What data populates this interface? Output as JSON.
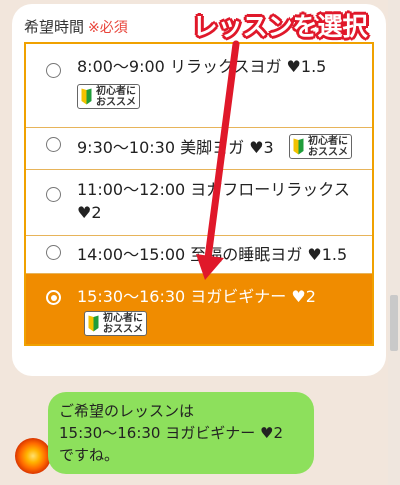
{
  "form": {
    "label": "希望時間",
    "required_mark": "※必須"
  },
  "options": [
    {
      "text": "8:00〜9:00 リラックスヨガ ♥1.5",
      "badge_line1": "初心者に",
      "badge_line2": "おススメ",
      "selected": false
    },
    {
      "text": "9:30〜10:30 美脚ヨガ ♥3",
      "badge_line1": "初心者に",
      "badge_line2": "おススメ",
      "selected": false
    },
    {
      "text_line1": "11:00〜12:00 ヨガフローリラックス",
      "text_line2": "♥2",
      "selected": false
    },
    {
      "text": "14:00〜15:00 至福の睡眠ヨガ ♥1.5",
      "selected": false
    },
    {
      "text": "15:30〜16:30 ヨガビギナー ♥2",
      "badge_line1": "初心者に",
      "badge_line2": "おススメ",
      "selected": true
    }
  ],
  "annotation": {
    "callout": "レッスンを選択",
    "color": "#e0182a"
  },
  "reply": {
    "line1": "ご希望のレッスンは",
    "line2": "15:30〜16:30 ヨガビギナー ♥2",
    "line3": "ですね。"
  },
  "colors": {
    "accent": "#f08c00",
    "bubble": "#8de05c",
    "background": "#f2e6dc"
  },
  "icons": {
    "beginner": "beginner-mark-icon",
    "avatar": "sun-avatar-icon"
  }
}
